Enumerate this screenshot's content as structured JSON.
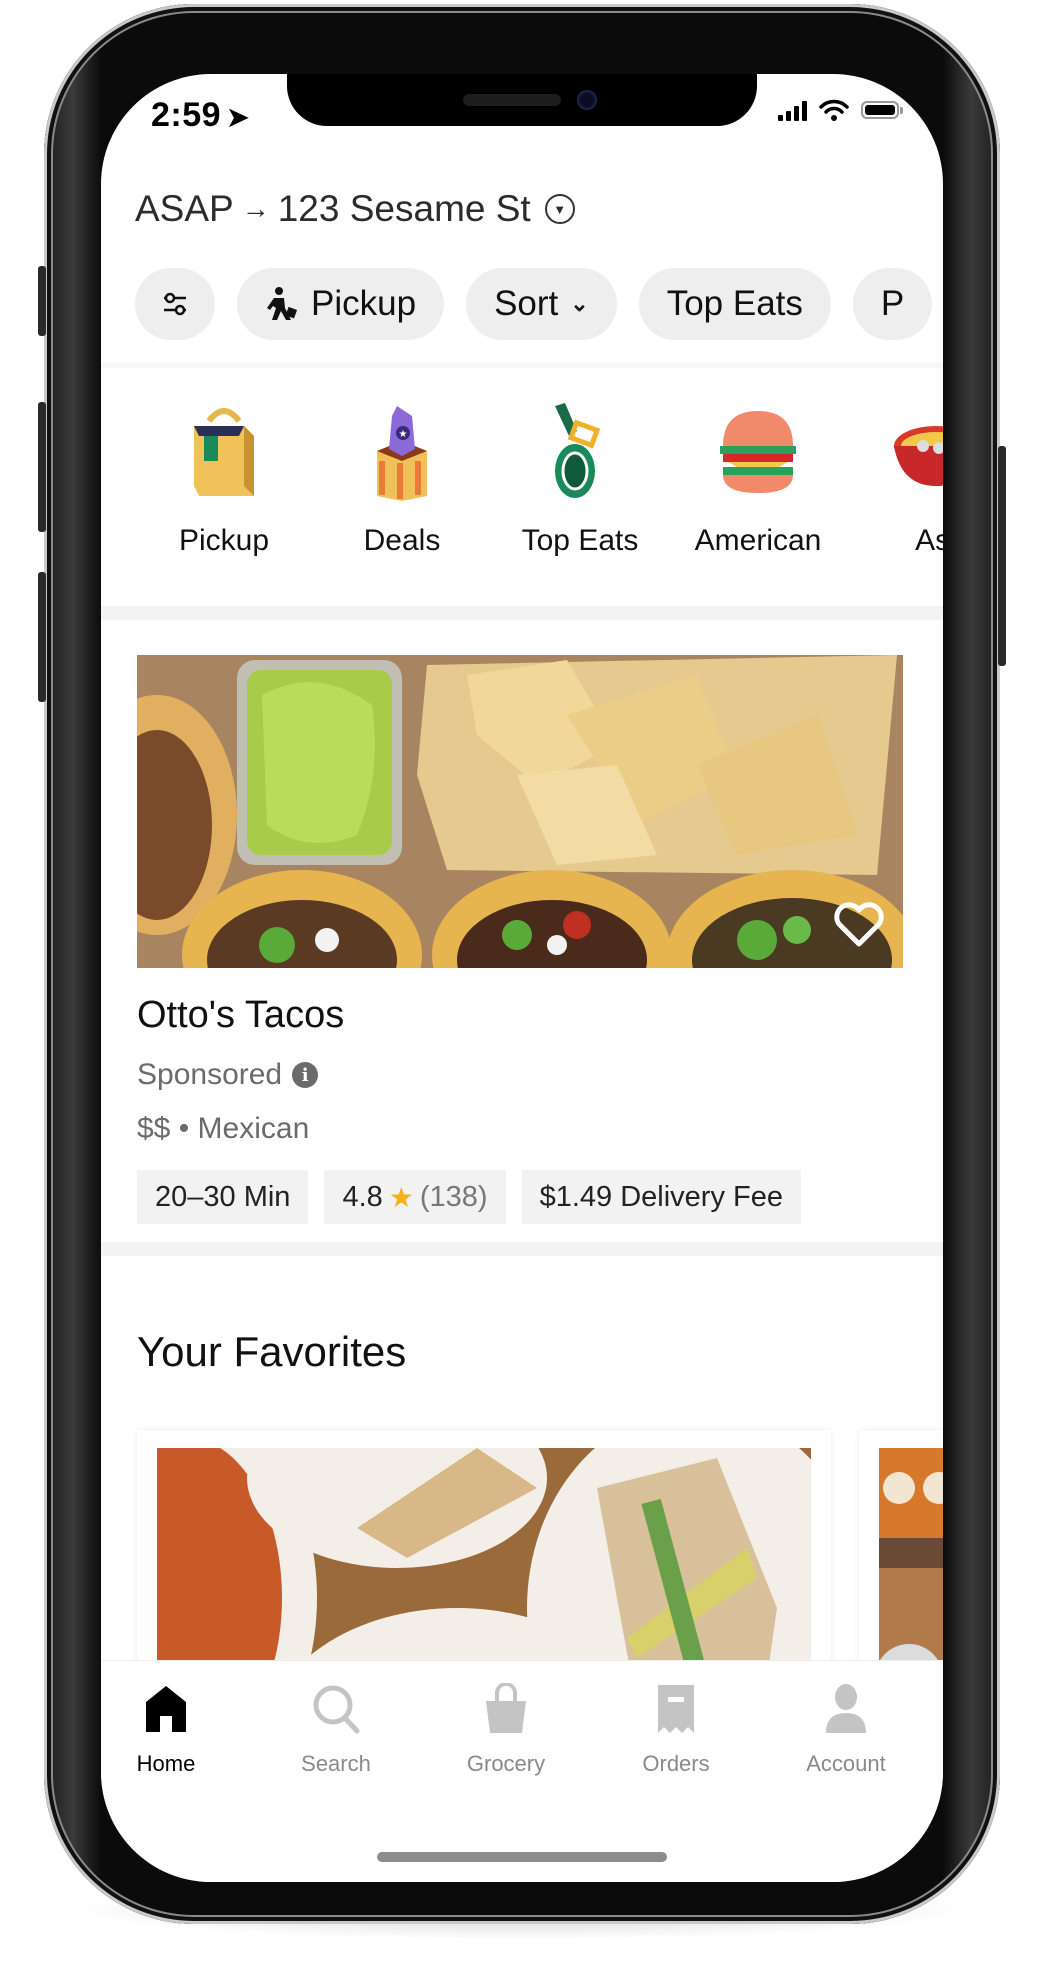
{
  "status_bar": {
    "time": "2:59",
    "location_icon": "location-arrow-icon",
    "signal_icon": "cellular-signal-icon",
    "wifi_icon": "wifi-icon",
    "battery_icon": "battery-icon"
  },
  "header": {
    "when": "ASAP",
    "arrow": "→",
    "address": "123 Sesame St",
    "dropdown_icon": "dropdown-circle-icon"
  },
  "filter_chips": [
    {
      "label": "",
      "icon": "filter-sliders-icon"
    },
    {
      "label": "Pickup",
      "icon": "walking-person-icon"
    },
    {
      "label": "Sort",
      "icon": "chevron-down-icon"
    },
    {
      "label": "Top Eats",
      "icon": ""
    },
    {
      "label": "P",
      "icon": ""
    }
  ],
  "categories": [
    {
      "label": "Pickup",
      "icon": "shopping-bag-icon"
    },
    {
      "label": "Deals",
      "icon": "price-tag-icon"
    },
    {
      "label": "Top Eats",
      "icon": "medal-icon"
    },
    {
      "label": "American",
      "icon": "burger-icon"
    },
    {
      "label": "Asi",
      "icon": "noodle-bowl-icon"
    }
  ],
  "featured_store": {
    "name": "Otto's Tacos",
    "sponsored": "Sponsored",
    "price_and_cuisine": "$$ • Mexican",
    "delivery_time": "20–30 Min",
    "rating": "4.8",
    "rating_count": "(138)",
    "delivery_fee": "$1.49 Delivery Fee",
    "favorite_icon": "heart-outline-icon",
    "colors": {
      "star": "#f6b01e"
    }
  },
  "favorites": {
    "title": "Your Favorites"
  },
  "tab_bar": {
    "items": [
      {
        "label": "Home",
        "icon": "home-icon",
        "active": true
      },
      {
        "label": "Search",
        "icon": "search-icon",
        "active": false
      },
      {
        "label": "Grocery",
        "icon": "grocery-bag-icon",
        "active": false
      },
      {
        "label": "Orders",
        "icon": "receipt-icon",
        "active": false
      },
      {
        "label": "Account",
        "icon": "account-person-icon",
        "active": false
      }
    ]
  }
}
